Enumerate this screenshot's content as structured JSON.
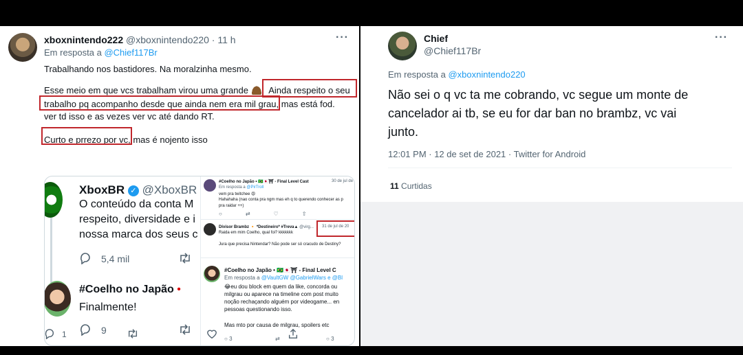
{
  "left_tweet": {
    "author_name": "xboxnintendo222",
    "author_handle_time": "@xboxnintendo220 · 11 h",
    "reply_prefix": "Em resposta a ",
    "reply_to": "@Chief117Br",
    "lines": {
      "l1": "Trabalhando nos bastidores. Na moralzinha mesmo.",
      "l2a": "Esse meio em que vcs trabalham virou uma grande",
      "l2b": "Ainda respeito o seu",
      "l3a": "trabalho pq acompanho desde que ainda nem era mil grau",
      "l3b": ", mas está fod.",
      "l4": "ver td isso e as vezes ver vc até dando RT.",
      "l5a": "Curto e prrezo por vc",
      "l5b": ", mas é nojento isso"
    },
    "actions": {
      "reply_count": "1"
    }
  },
  "embed_xbox": {
    "name": "XboxBR",
    "handle": "@XboxBR ·",
    "text1": "O conteúdo da conta M",
    "text2": "respeito, diversidade e i",
    "text3": "nossa marca dos seus c",
    "likes": "5,4 mil"
  },
  "embed_coelho": {
    "name": "#Coelho no Japão",
    "text": "Finalmente!",
    "replies": "9"
  },
  "mini1": {
    "name": "#Coelho no Japão • 🇧🇷🇯🇵⛩ - Final Level Cast",
    "date": "30 de jul de",
    "reply_prefix": "Em resposta a ",
    "reply_to": "@PirTroll",
    "text1": "vem pra twitchee 😡",
    "text2": "Hahahaha (nao conta pra ngm mas eh q to querendo conhecer as p",
    "text3": "pra raidar ++)"
  },
  "mini2": {
    "name": "Divisor Brambz 🔸 *Destineiro* #Treva▲",
    "handle": "@virg...",
    "date": "31 de jul de 20",
    "text1": "Raida em mim Coelho, qual foi? kkkkkkk",
    "text2": "Jura que precisa Nintendar? Não pode ser só cracudo de Destiny?"
  },
  "mini3": {
    "name": "#Coelho no Japão • 🇧🇷🇯🇵⛩ - Final Level C",
    "reply_prefix": "Em resposta a ",
    "reply_to": "@VaultGW @GabrielWars e @Bl",
    "text1": "😂eu dou block em quem da like, concorda ou",
    "text2": "milgrau ou aparece na timeline com post muito",
    "text3": "noção rechaçando alguém por videogame... en",
    "text4": "pessoas questionando isso.",
    "text5": "Mas mto por causa de milgrau, spoilers etc",
    "count1": "3",
    "count2": "3"
  },
  "right_tweet": {
    "author_name": "Chief",
    "author_handle": "@Chief117Br",
    "reply_prefix": "Em resposta a ",
    "reply_to": "@xboxnintendo220",
    "text1": "Não sei o q vc ta me cobrando, vc segue um monte de",
    "text2": "cancelador ai tb, se eu for dar ban no brambz, vc vai",
    "text3": "junto.",
    "meta": "12:01 PM · 12 de set de 2021 · Twitter for Android",
    "likes_count": "11",
    "likes_label": "Curtidas"
  },
  "colors": {
    "accent": "#1d9bf0",
    "highlight_box": "#c0262b",
    "muted": "#536471"
  }
}
